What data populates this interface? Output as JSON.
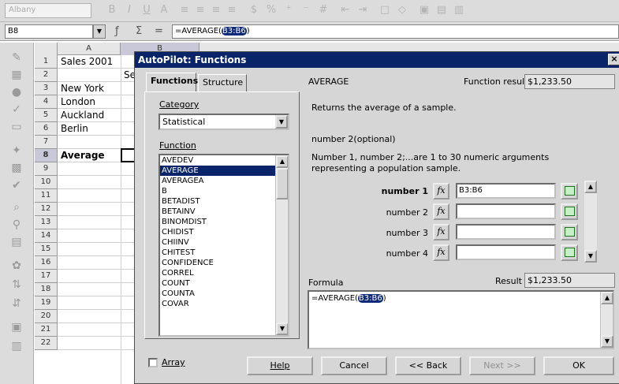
{
  "toolbar": {
    "font_name": "Albany"
  },
  "formula_bar": {
    "cell_ref": "B8",
    "formula_prefix": "=AVERAGE(",
    "formula_selected": "B3:B6",
    "formula_suffix": ")"
  },
  "sheet": {
    "columns": [
      "A",
      "B"
    ],
    "rows": [
      {
        "num": "1",
        "a": "Sales 2001"
      },
      {
        "num": "2",
        "a": "",
        "b": "Se"
      },
      {
        "num": "3",
        "a": "New York"
      },
      {
        "num": "4",
        "a": "London"
      },
      {
        "num": "5",
        "a": "Auckland"
      },
      {
        "num": "6",
        "a": "Berlin"
      },
      {
        "num": "7",
        "a": ""
      },
      {
        "num": "8",
        "a": "Average"
      },
      {
        "num": "9",
        "a": ""
      },
      {
        "num": "10",
        "a": ""
      },
      {
        "num": "11",
        "a": ""
      },
      {
        "num": "12",
        "a": ""
      },
      {
        "num": "13",
        "a": ""
      },
      {
        "num": "14",
        "a": ""
      },
      {
        "num": "15",
        "a": ""
      },
      {
        "num": "16",
        "a": ""
      },
      {
        "num": "17",
        "a": ""
      },
      {
        "num": "18",
        "a": ""
      },
      {
        "num": "19",
        "a": ""
      },
      {
        "num": "20",
        "a": ""
      },
      {
        "num": "21",
        "a": ""
      },
      {
        "num": "22",
        "a": ""
      }
    ]
  },
  "dialog": {
    "title": "AutoPilot: Functions",
    "close_label": "×",
    "tabs": [
      {
        "label": "Functions",
        "active": true
      },
      {
        "label": "Structure",
        "active": false
      }
    ],
    "category_label": "Category",
    "category_value": "Statistical",
    "function_label": "Function",
    "functions": [
      "AVEDEV",
      "AVERAGE",
      "AVERAGEA",
      "B",
      "BETADIST",
      "BETAINV",
      "BINOMDIST",
      "CHIDIST",
      "CHIINV",
      "CHITEST",
      "CONFIDENCE",
      "CORREL",
      "COUNT",
      "COUNTA",
      "COVAR"
    ],
    "selected_function": "AVERAGE",
    "function_name": "AVERAGE",
    "function_result_label": "Function result",
    "function_result_value": "$1,233.50",
    "description": "Returns the average of a sample.",
    "argument_title": "number 2(optional)",
    "argument_description": "Number 1, number 2;...are 1 to 30 numeric arguments representing a population sample.",
    "arguments": [
      {
        "label": "number 1",
        "value": "B3:B6",
        "bold": true
      },
      {
        "label": "number 2",
        "value": "",
        "bold": false
      },
      {
        "label": "number 3",
        "value": "",
        "bold": false
      },
      {
        "label": "number 4",
        "value": "",
        "bold": false
      }
    ],
    "fx_label": "fx",
    "formula_label": "Formula",
    "result_label": "Result",
    "result_value": "$1,233.50",
    "formula_prefix": "=AVERAGE(",
    "formula_selected": "B3:B6",
    "formula_suffix": ")",
    "array_label": "Array",
    "buttons": {
      "help": "Help",
      "cancel": "Cancel",
      "back": "<< Back",
      "next": "Next >>",
      "ok": "OK"
    }
  },
  "colors": {
    "title_bar": "#0a246a",
    "selection": "#0a246a",
    "dialog_bg": "#d6d6d6"
  }
}
